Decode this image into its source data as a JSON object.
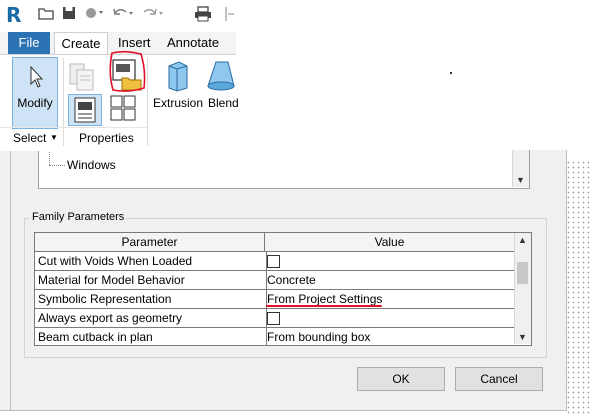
{
  "ribbon": {
    "qat_icons": [
      "open-icon",
      "save-icon",
      "sync-icon",
      "undo-icon",
      "redo-icon",
      "print-icon"
    ],
    "tabs": [
      "File",
      "Create",
      "Insert",
      "Annotate"
    ],
    "modify_label": "Modify",
    "select_label": "Select",
    "properties_label": "Properties",
    "extrusion_label": "Extrusion",
    "blend_label": "Blend"
  },
  "dialog": {
    "category_item": "Windows",
    "family_parameters_legend": "Family Parameters",
    "table": {
      "headers": [
        "Parameter",
        "Value"
      ],
      "rows": [
        {
          "parameter": "Cut with Voids When Loaded",
          "value": "",
          "checkbox": true
        },
        {
          "parameter": "Material for Model Behavior",
          "value": "Concrete",
          "checkbox": false
        },
        {
          "parameter": "Symbolic Representation",
          "value": "From Project Settings",
          "checkbox": false
        },
        {
          "parameter": "Always export as geometry",
          "value": "",
          "checkbox": true
        },
        {
          "parameter": "Beam cutback in plan",
          "value": "From bounding box",
          "checkbox": false
        }
      ]
    },
    "ok_label": "OK",
    "cancel_label": "Cancel"
  },
  "colors": {
    "file_tab": "#2c73b4",
    "highlight": "#cfe3f6",
    "annotation_red": "#e0102a"
  }
}
